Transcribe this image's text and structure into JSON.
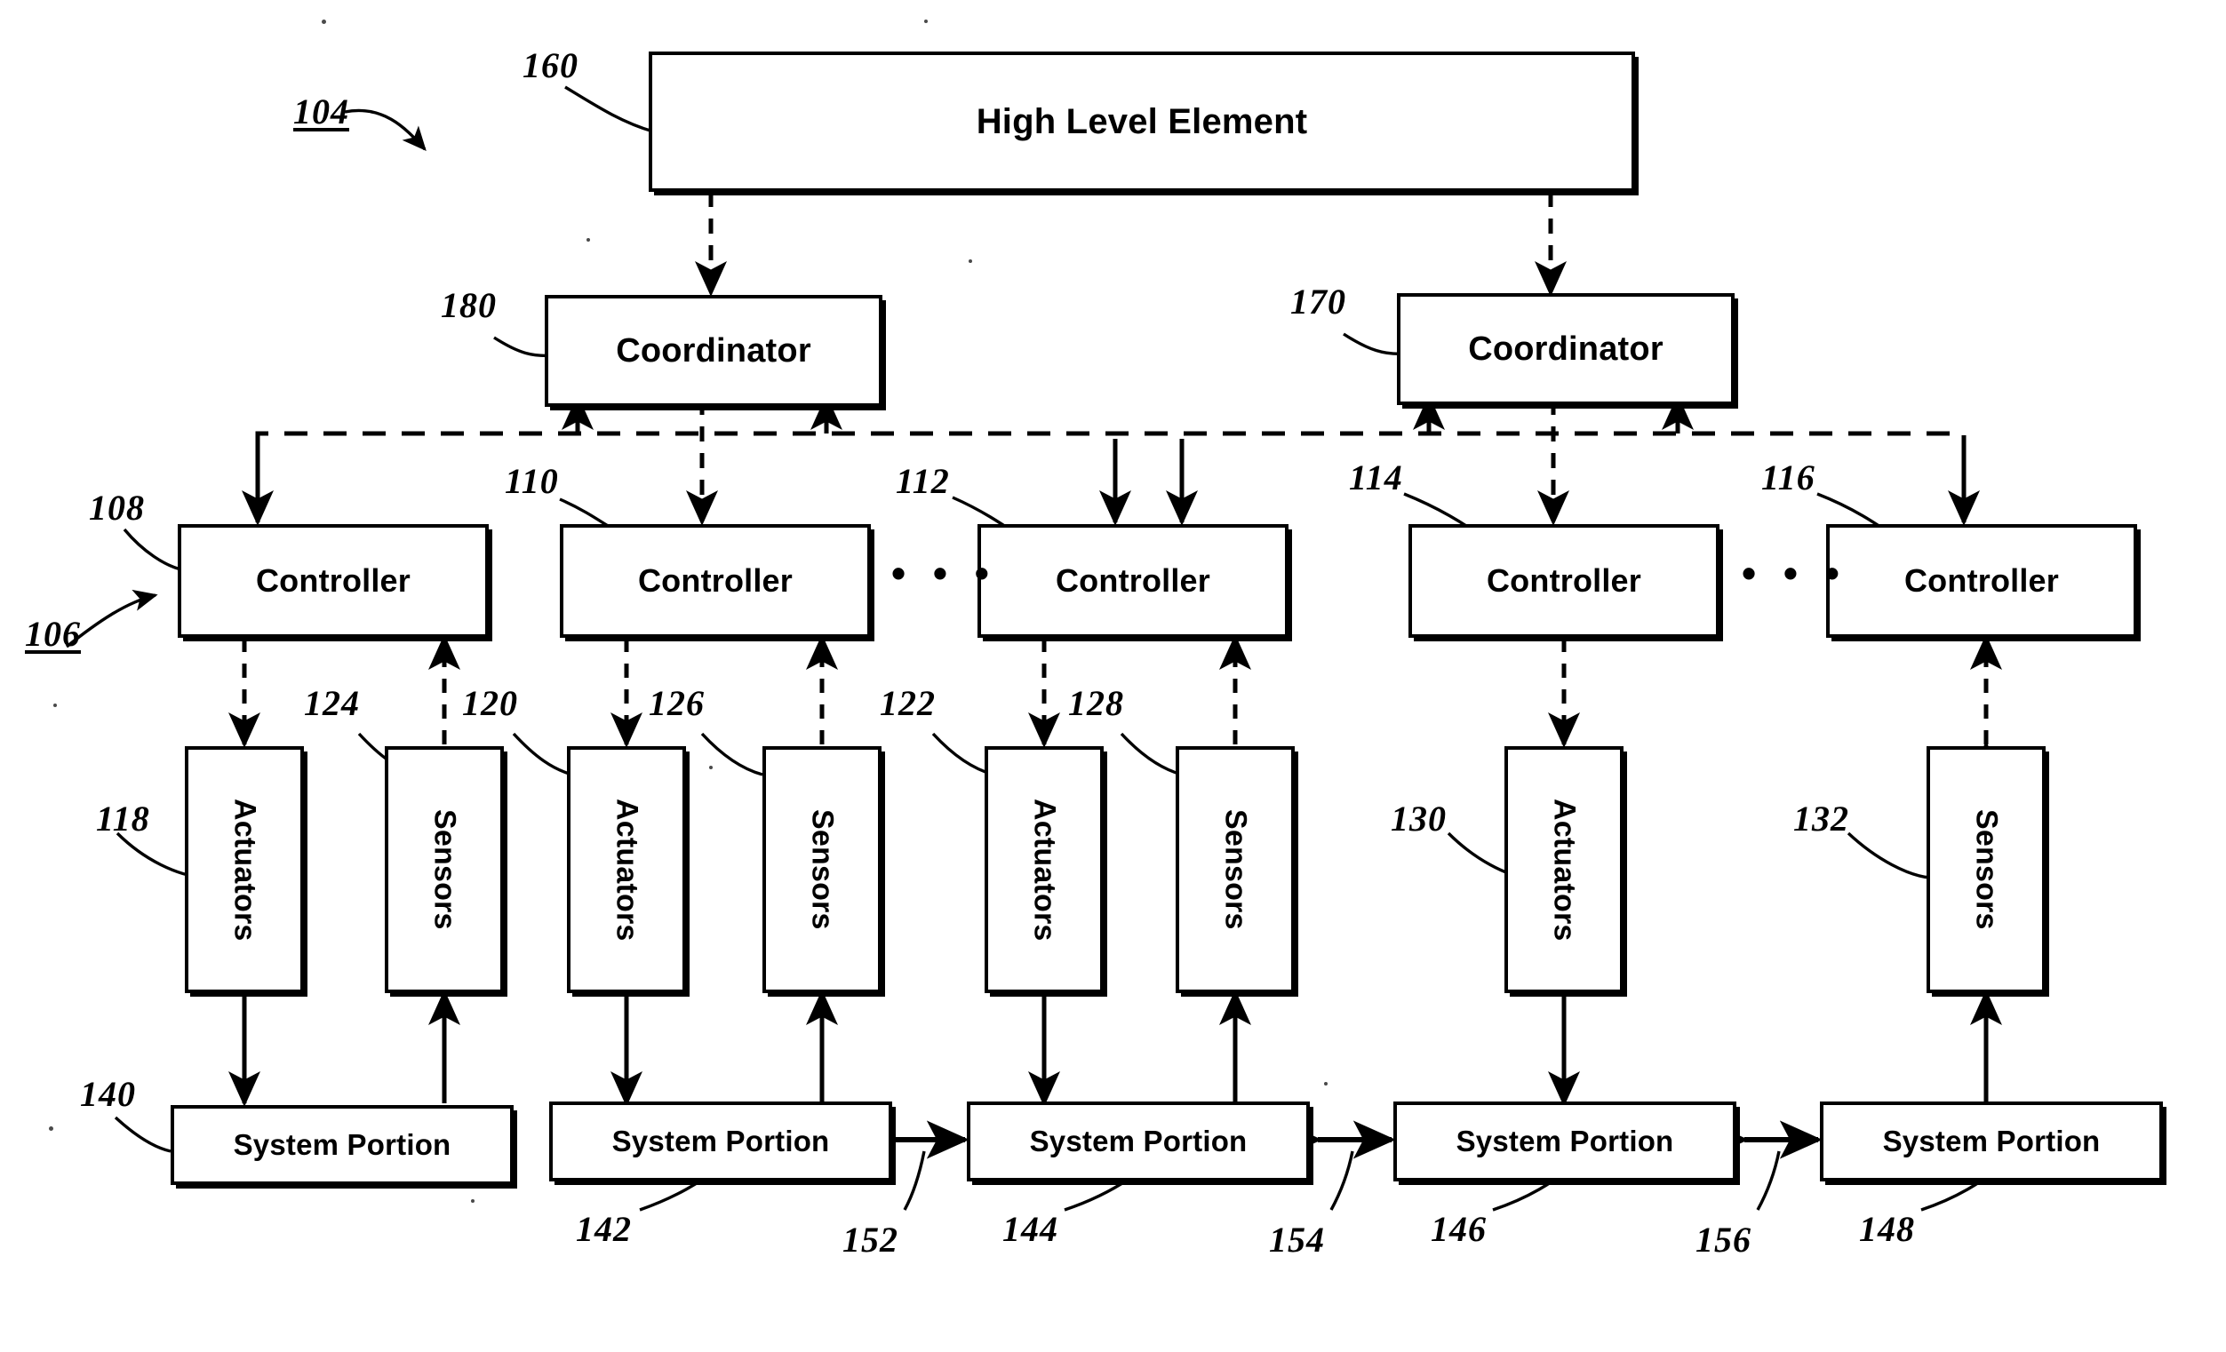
{
  "figure": {
    "kind": "patent-block-diagram",
    "title_ref": "104",
    "description": "Hierarchical control system block diagram"
  },
  "nodes": {
    "high_level_element": {
      "label": "High Level Element",
      "ref": "160"
    },
    "coordinators": [
      {
        "label": "Coordinator",
        "ref": "180"
      },
      {
        "label": "Coordinator",
        "ref": "170"
      }
    ],
    "controllers": [
      {
        "label": "Controller",
        "ref": "108"
      },
      {
        "label": "Controller",
        "ref": "110"
      },
      {
        "label": "Controller",
        "ref": "112"
      },
      {
        "label": "Controller",
        "ref": "114"
      },
      {
        "label": "Controller",
        "ref": "116"
      }
    ],
    "actuators": [
      {
        "label": "Actuators",
        "ref": "118"
      },
      {
        "label": "Actuators",
        "ref": "120"
      },
      {
        "label": "Actuators",
        "ref": "122"
      },
      {
        "label": "Actuators",
        "ref": "130"
      }
    ],
    "sensors": [
      {
        "label": "Sensors",
        "ref": "124"
      },
      {
        "label": "Sensors",
        "ref": "126"
      },
      {
        "label": "Sensors",
        "ref": "128"
      },
      {
        "label": "Sensors",
        "ref": "132"
      }
    ],
    "system_portions": [
      {
        "label": "System Portion",
        "ref": "140"
      },
      {
        "label": "System Portion",
        "ref": "142"
      },
      {
        "label": "System Portion",
        "ref": "144"
      },
      {
        "label": "System Portion",
        "ref": "146"
      },
      {
        "label": "System Portion",
        "ref": "148"
      }
    ]
  },
  "reference_numerals": {
    "system": "104",
    "control_layer": "106",
    "controller_1": "108",
    "controller_2": "110",
    "controller_3": "112",
    "controller_4": "114",
    "controller_5": "116",
    "actuators_1": "118",
    "actuators_2": "120",
    "actuators_3": "122",
    "actuators_4": "130",
    "sensors_1": "124",
    "sensors_2": "126",
    "sensors_3": "128",
    "sensors_4": "132",
    "system_portion_1": "140",
    "system_portion_2": "142",
    "system_portion_3": "144",
    "system_portion_4": "146",
    "system_portion_5": "148",
    "coupling_1": "152",
    "coupling_2": "154",
    "coupling_3": "156",
    "high_level_element": "160",
    "coordinator_right": "170",
    "coordinator_left": "180"
  },
  "ellipses": {
    "between_controllers_2_3": "• • •",
    "between_controllers_4_5": "• • •"
  },
  "colors": {
    "line": "#000000",
    "background": "#ffffff",
    "text": "#000000"
  }
}
